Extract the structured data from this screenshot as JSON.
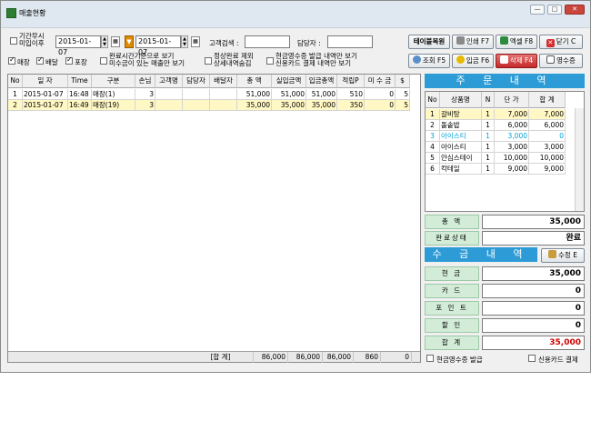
{
  "window": {
    "title": "매출현황",
    "min": "—",
    "max": "□",
    "close": "✕"
  },
  "filters": {
    "opt_timeless_label1": "기간무시",
    "opt_timeless_label2": "미입이후",
    "date_from": "2015-01-07",
    "date_to": "2015-01-07",
    "customer_search_label": "고객검색 :",
    "manager_label": "담당자 :",
    "chk_store": "매장",
    "chk_delivery": "배달",
    "chk_pickup": "포장",
    "opt_complete_time1": "완료시간기준으로 보기",
    "opt_complete_time2": "미수금이 있는 매출만 보기",
    "opt_settle1": "정상완료 제외",
    "opt_settle2": "상세내역숨김",
    "opt_cash1": "현금영수증 발급 내역만 보기",
    "opt_cash2": "신용카드 결제 내역만 보기"
  },
  "toolbar": {
    "table_restore": "테이블복원",
    "print": "인쇄 F7",
    "excel": "엑셀 F8",
    "close": "닫기 C",
    "search": "조회 F5",
    "deposit": "입금 F6",
    "delete": "삭제 F4",
    "receipt": "영수증"
  },
  "sales": {
    "columns": [
      "No",
      "일 자",
      "Time",
      "구분",
      "손님",
      "고객명",
      "담당자",
      "배달자",
      "총 액",
      "실입금액",
      "입금총액",
      "적립P",
      "미 수 금",
      "$"
    ],
    "rows": [
      [
        "1",
        "2015-01-07",
        "16:48",
        "매장(1)",
        "3",
        "",
        "",
        "",
        "51,000",
        "51,000",
        "51,000",
        "510",
        "0",
        "5"
      ],
      [
        "2",
        "2015-01-07",
        "16:49",
        "매장(19)",
        "3",
        "",
        "",
        "",
        "35,000",
        "35,000",
        "35,000",
        "350",
        "0",
        "5"
      ]
    ],
    "footer": {
      "label": "[합 계]",
      "c1": "86,000",
      "c2": "86,000",
      "c3": "86,000",
      "c4": "860",
      "c5": "0"
    }
  },
  "order": {
    "header": "주 문 내 역",
    "columns": [
      "No",
      "상품명",
      "N",
      "단 가",
      "합 계"
    ],
    "rows": [
      [
        "1",
        "갈비탕",
        "1",
        "7,000",
        "7,000"
      ],
      [
        "2",
        "돌솥밥",
        "1",
        "6,000",
        "6,000"
      ],
      [
        "3",
        "아이스티",
        "1",
        "3,000",
        "0"
      ],
      [
        "4",
        "아이스티",
        "1",
        "3,000",
        "3,000"
      ],
      [
        "5",
        "안심스테이",
        "1",
        "10,000",
        "10,000"
      ],
      [
        "6",
        "칵테일",
        "1",
        "9,000",
        "9,000"
      ]
    ],
    "total_label": "총 액",
    "total_value": "35,000",
    "status_label": "완료상태",
    "status_value": "완료"
  },
  "payment": {
    "header": "수 금 내 역",
    "edit_button": "수정 E",
    "cash_label": "현 금",
    "cash_value": "35,000",
    "card_label": "카 드",
    "card_value": "0",
    "point_label": "포 인 트",
    "point_value": "0",
    "discount_label": "할 인",
    "discount_value": "0",
    "sum_label": "합 계",
    "sum_value": "35,000",
    "cash_receipt": "현금영수증 발급",
    "credit_card": "신용카드 결제"
  },
  "colors": {
    "accent": "#2c9bd6",
    "label_bg": "#d3ecd8",
    "selected_row": "#fff8c4",
    "red": "#d00000",
    "cyan": "#00a0d8"
  }
}
